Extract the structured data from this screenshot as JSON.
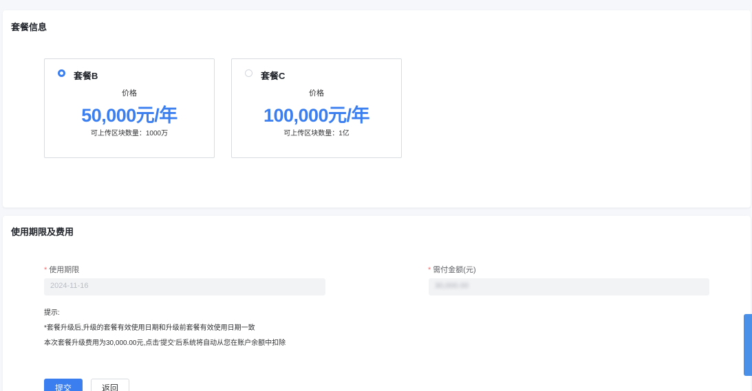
{
  "plan_section": {
    "title": "套餐信息",
    "plans": [
      {
        "name": "套餐B",
        "price_label": "价格",
        "price": "50,000元/年",
        "quota": "可上传区块数量：1000万",
        "selected": true
      },
      {
        "name": "套餐C",
        "price_label": "价格",
        "price": "100,000元/年",
        "quota": "可上传区块数量：1亿",
        "selected": false
      }
    ]
  },
  "fee_section": {
    "title": "使用期限及费用",
    "period": {
      "required_mark": "*",
      "label": "使用期限",
      "value": "2024-11-16"
    },
    "amount": {
      "required_mark": "*",
      "label": "需付金额(元)",
      "value": "30,000.00"
    },
    "tips": [
      "提示:",
      "*套餐升级后,升级的套餐有效使用日期和升级前套餐有效使用日期一致",
      "本次套餐升级费用为30,000.00元,点击'提交'后系统将自动从您在账户余额中扣除"
    ],
    "submit_label": "提交",
    "back_label": "返回"
  },
  "colors": {
    "accent": "#3a7ef0",
    "required": "#f56c6c",
    "border": "#d8dbe0",
    "background": "#f5f7fa"
  }
}
